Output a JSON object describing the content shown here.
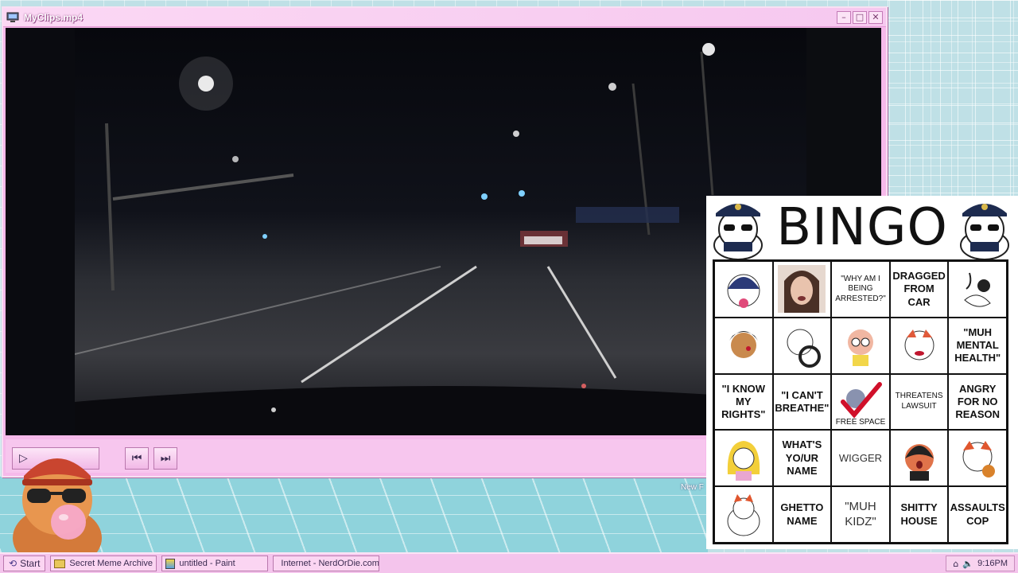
{
  "window": {
    "title": "MyClips.mp4",
    "minimize_icon": "minimize-icon",
    "maximize_icon": "maximize-icon",
    "close_icon": "close-icon"
  },
  "player": {
    "controls": [
      "play",
      "previous-track",
      "next-track"
    ]
  },
  "desktop": {
    "icon_label": "New F"
  },
  "bingo": {
    "title": "BINGO",
    "cells": [
      {
        "text": "",
        "icon": "nun-cat-sticker"
      },
      {
        "text": "",
        "icon": "crying-woman-photo"
      },
      {
        "text": "\"WHY AM I BEING ARRESTED?\""
      },
      {
        "text": "DRAGGED FROM CAR"
      },
      {
        "text": "",
        "icon": "fainting-cat-sticker"
      },
      {
        "text": "",
        "icon": "bleeding-boy-sticker"
      },
      {
        "text": "",
        "icon": "driving-cat-sticker"
      },
      {
        "text": "",
        "icon": "cute-girl-sticker"
      },
      {
        "text": "",
        "icon": "sad-cat-sticker"
      },
      {
        "text": "\"MUH MENTAL HEALTH\""
      },
      {
        "text": "\"I KNOW MY RIGHTS\""
      },
      {
        "text": "\"I CAN'T BREATHE\""
      },
      {
        "text": "FREE SPACE",
        "icon": "checkmark-icon"
      },
      {
        "text": "THREATENS LAWSUIT"
      },
      {
        "text": "ANGRY FOR NO REASON"
      },
      {
        "text": "",
        "icon": "blonde-girl-sticker"
      },
      {
        "text": "WHAT'S YO/UR NAME"
      },
      {
        "text": "WIGGER"
      },
      {
        "text": "",
        "icon": "shocked-cat-sticker"
      },
      {
        "text": "",
        "icon": "grumpy-cat-sticker"
      },
      {
        "text": "",
        "icon": "chubby-cat-sticker"
      },
      {
        "text": "GHETTO NAME"
      },
      {
        "text": "\"MUH KIDZ\""
      },
      {
        "text": "SHITTY HOUSE"
      },
      {
        "text": "ASSAULTS COP"
      }
    ]
  },
  "taskbar": {
    "start_label": "Start",
    "tasks": [
      {
        "label": "Secret Meme Archive",
        "icon": "folder-icon"
      },
      {
        "label": "untitled - Paint",
        "icon": "paint-icon"
      },
      {
        "label": "Internet - NerdOrDie.com",
        "icon": "globe-icon"
      }
    ],
    "clock": "9:16PM"
  },
  "colors": {
    "window": "#f6b9ea",
    "taskbar": "#f4c4ec",
    "check": "#d0102a"
  }
}
